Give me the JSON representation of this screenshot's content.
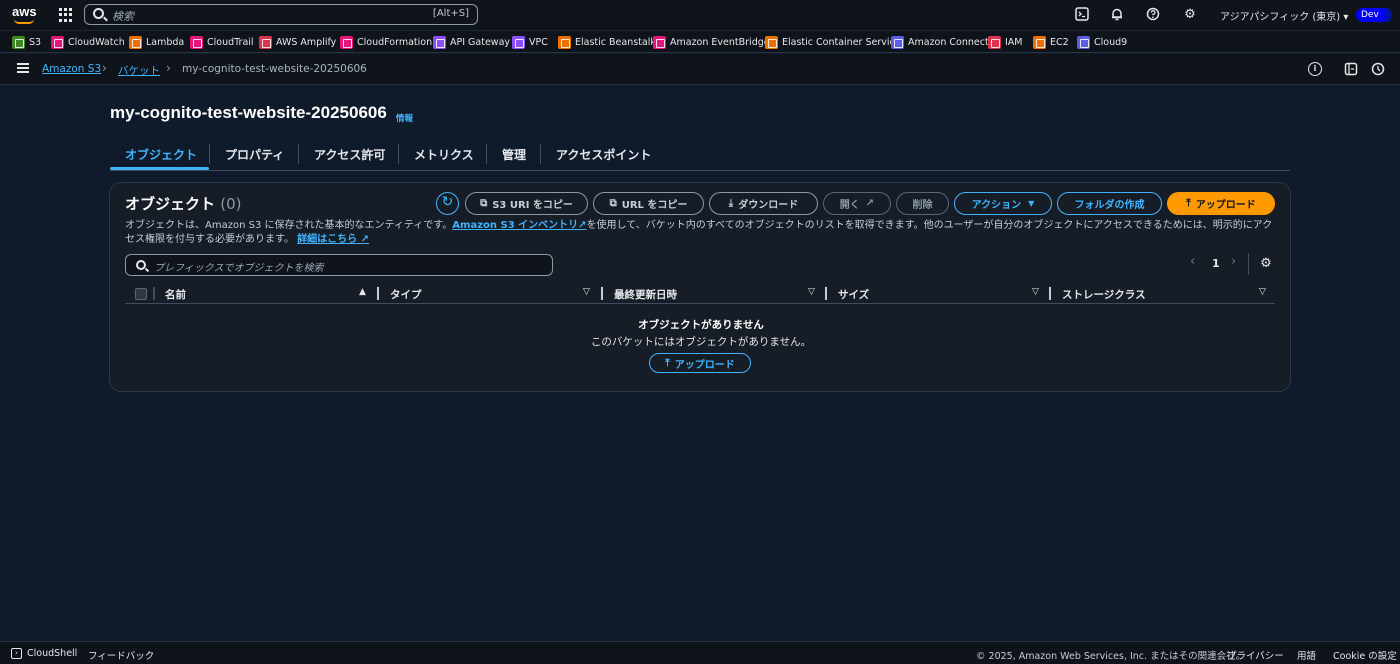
{
  "topbar": {
    "logo_text": "aws",
    "search_placeholder": "検索",
    "search_shortcut": "[Alt+S]",
    "region": "アジアパシフィック (東京) ▾",
    "account_badge": "Dev"
  },
  "favorites": [
    {
      "label": "S3",
      "color": "#3f8624"
    },
    {
      "label": "CloudWatch",
      "color": "#e7157b"
    },
    {
      "label": "Lambda",
      "color": "#ed7100"
    },
    {
      "label": "CloudTrail",
      "color": "#e7157b"
    },
    {
      "label": "AWS Amplify",
      "color": "#dd344c"
    },
    {
      "label": "CloudFormation",
      "color": "#e7157b"
    },
    {
      "label": "API Gateway",
      "color": "#8c4fff"
    },
    {
      "label": "VPC",
      "color": "#8c4fff"
    },
    {
      "label": "Elastic Beanstalk",
      "color": "#ed7100"
    },
    {
      "label": "Amazon EventBridge",
      "color": "#e7157b"
    },
    {
      "label": "Elastic Container Service",
      "color": "#ed7100"
    },
    {
      "label": "Amazon Connect",
      "color": "#5a5ce6"
    },
    {
      "label": "IAM",
      "color": "#dd344c"
    },
    {
      "label": "EC2",
      "color": "#ed7100"
    },
    {
      "label": "Cloud9",
      "color": "#5a5ce6"
    }
  ],
  "breadcrumb": {
    "root": "Amazon S3",
    "buckets": "バケット",
    "current": "my-cognito-test-website-20250606"
  },
  "page": {
    "title": "my-cognito-test-website-20250606",
    "info": "情報"
  },
  "tabs": [
    "オブジェクト",
    "プロパティ",
    "アクセス許可",
    "メトリクス",
    "管理",
    "アクセスポイント"
  ],
  "objects_panel": {
    "heading": "オブジェクト",
    "count": "(0)",
    "buttons": {
      "copy_s3_uri": "S3 URI をコピー",
      "copy_url": "URL をコピー",
      "download": "ダウンロード",
      "open": "開く",
      "delete": "削除",
      "actions": "アクション",
      "create_folder": "フォルダの作成",
      "upload": "アップロード"
    },
    "description_pre": "オブジェクトは、Amazon S3 に保存された基本的なエンティティです。",
    "description_link": "Amazon S3 インベントリ",
    "description_mid": "を使用して、バケット内のすべてのオブジェクトのリストを取得できます。他のユーザーが自分のオブジェクトにアクセスできるためには、明示的にアクセス権限を付与する必要があります。",
    "description_more": "詳細はこちら",
    "filter_placeholder": "プレフィックスでオブジェクトを検索",
    "page_number": "1",
    "columns": [
      "名前",
      "タイプ",
      "最終更新日時",
      "サイズ",
      "ストレージクラス"
    ],
    "empty_title": "オブジェクトがありません",
    "empty_subtitle": "このバケットにはオブジェクトがありません。",
    "empty_upload": "アップロード"
  },
  "footer": {
    "cloudshell": "CloudShell",
    "feedback": "フィードバック",
    "copyright": "© 2025, Amazon Web Services, Inc. またはその関連会社。",
    "privacy": "プライバシー",
    "terms": "用語",
    "cookie": "Cookie の設定"
  }
}
